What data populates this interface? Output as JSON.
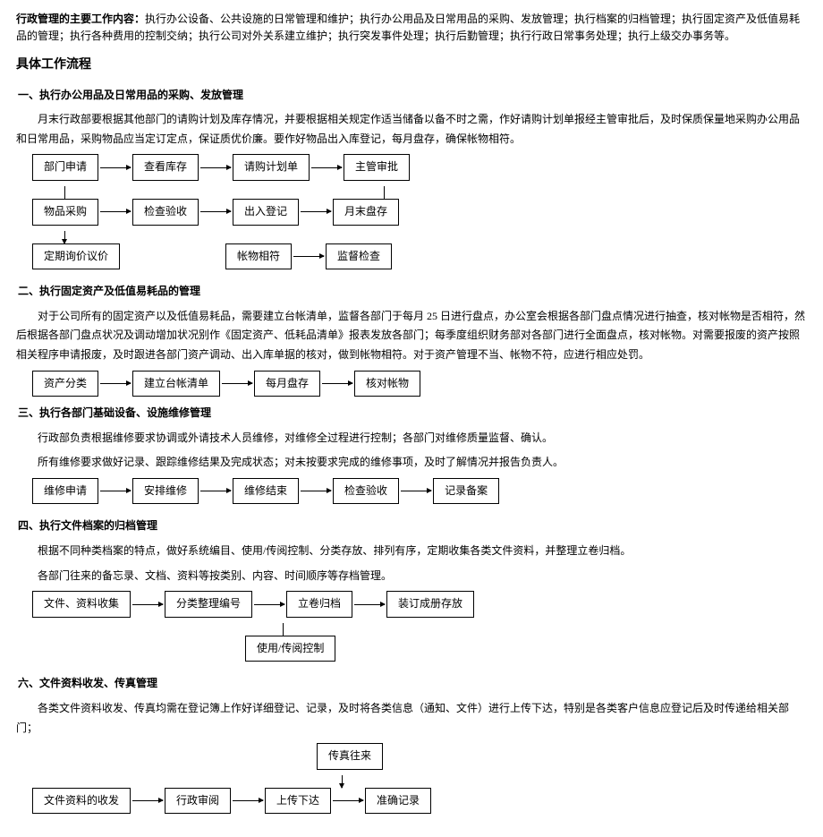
{
  "intro": {
    "label": "行政管理的主要工作内容：",
    "text": "执行办公设备、公共设施的日常管理和维护；执行办公用品及日常用品的采购、发放管理；执行档案的归档管理；执行固定资产及低值易耗品的管理；执行各种费用的控制交纳；执行公司对外关系建立维护；执行突发事件处理；执行后勤管理；执行行政日常事务处理；执行上级交办事务等。"
  },
  "main_title": "具体工作流程",
  "s1": {
    "title": "一、执行办公用品及日常用品的采购、发放管理",
    "p1": "月末行政部要根据其他部门的请购计划及库存情况，并要根据相关规定作适当储备以备不时之需，作好请购计划单报经主管审批后，及时保质保量地采购办公用品和日常用品，采购物品应当定订定点，保证质优价廉。要作好物品出入库登记，每月盘存，确保帐物相符。",
    "r1": [
      "部门申请",
      "查看库存",
      "请购计划单",
      "主管审批"
    ],
    "r2": [
      "物品采购",
      "检查验收",
      "出入登记",
      "月末盘存"
    ],
    "r3a": "定期询价议价",
    "r3b": "帐物相符",
    "r3c": "监督检查"
  },
  "s2": {
    "title": "二、执行固定资产及低值易耗品的管理",
    "p1": "对于公司所有的固定资产以及低值易耗品，需要建立台帐清单，监督各部门于每月 25 日进行盘点，办公室会根据各部门盘点情况进行抽查，核对帐物是否相符，然后根据各部门盘点状况及调动增加状况别作《固定资产、低耗品清单》报表发放各部门；每季度组织财务部对各部门进行全面盘点，核对帐物。对需要报废的资产按照相关程序申请报废，及时跟进各部门资产调动、出入库单据的核对，做到帐物相符。对于资产管理不当、帐物不符，应进行相应处罚。",
    "boxes": [
      "资产分类",
      "建立台帐清单",
      "每月盘存",
      "核对帐物"
    ]
  },
  "s3": {
    "title": "三、执行各部门基础设备、设施维修管理",
    "p1": "行政部负责根据维修要求协调或外请技术人员维修，对维修全过程进行控制；各部门对维修质量监督、确认。",
    "p2": "所有维修要求做好记录、跟踪维修结果及完成状态；对未按要求完成的维修事项，及时了解情况并报告负责人。",
    "boxes": [
      "维修申请",
      "安排维修",
      "维修结束",
      "检查验收",
      "记录备案"
    ]
  },
  "s4": {
    "title": "四、执行文件档案的归档管理",
    "p1": "根据不同种类档案的特点，做好系统编目、使用/传阅控制、分类存放、排列有序，定期收集各类文件资料，并整理立卷归档。",
    "p2": "各部门往来的备忘录、文档、资料等按类别、内容、时间顺序等存档管理。",
    "r1": [
      "文件、资料收集",
      "分类整理编号",
      "立卷归档",
      "装订成册存放"
    ],
    "r2": "使用/传阅控制"
  },
  "s6": {
    "title": "六、文件资料收发、传真管理",
    "p1": "各类文件资料收发、传真均需在登记簿上作好详细登记、记录，及时将各类信息（通知、文件）进行上传下达，特别是各类客户信息应登记后及时传递给相关部门；",
    "r0": "传真往来",
    "r1": [
      "文件资料的收发",
      "行政审阅",
      "上传下达",
      "准确记录"
    ]
  }
}
